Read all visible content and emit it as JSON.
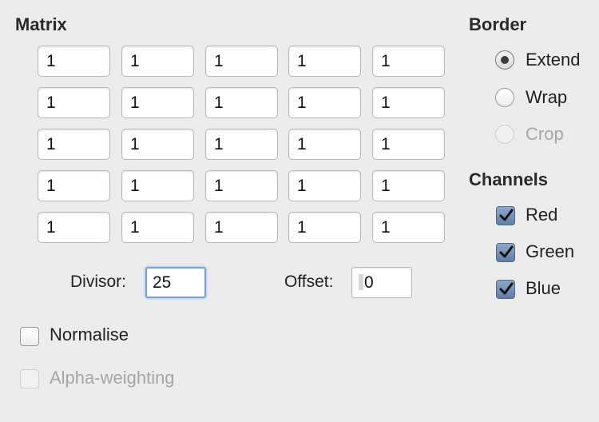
{
  "matrix": {
    "title": "Matrix",
    "rows": [
      [
        "1",
        "1",
        "1",
        "1",
        "1"
      ],
      [
        "1",
        "1",
        "1",
        "1",
        "1"
      ],
      [
        "1",
        "1",
        "1",
        "1",
        "1"
      ],
      [
        "1",
        "1",
        "1",
        "1",
        "1"
      ],
      [
        "1",
        "1",
        "1",
        "1",
        "1"
      ]
    ]
  },
  "divisor": {
    "label": "Divisor:",
    "value": "25"
  },
  "offset": {
    "label": "Offset:",
    "value": "0"
  },
  "normalise": {
    "label": "Normalise",
    "checked": false
  },
  "alpha_weighting": {
    "label": "Alpha-weighting",
    "checked": false,
    "enabled": false
  },
  "border": {
    "title": "Border",
    "options": [
      {
        "label": "Extend",
        "selected": true,
        "enabled": true
      },
      {
        "label": "Wrap",
        "selected": false,
        "enabled": true
      },
      {
        "label": "Crop",
        "selected": false,
        "enabled": false
      }
    ]
  },
  "channels": {
    "title": "Channels",
    "items": [
      {
        "label": "Red",
        "checked": true
      },
      {
        "label": "Green",
        "checked": true
      },
      {
        "label": "Blue",
        "checked": true
      }
    ]
  }
}
